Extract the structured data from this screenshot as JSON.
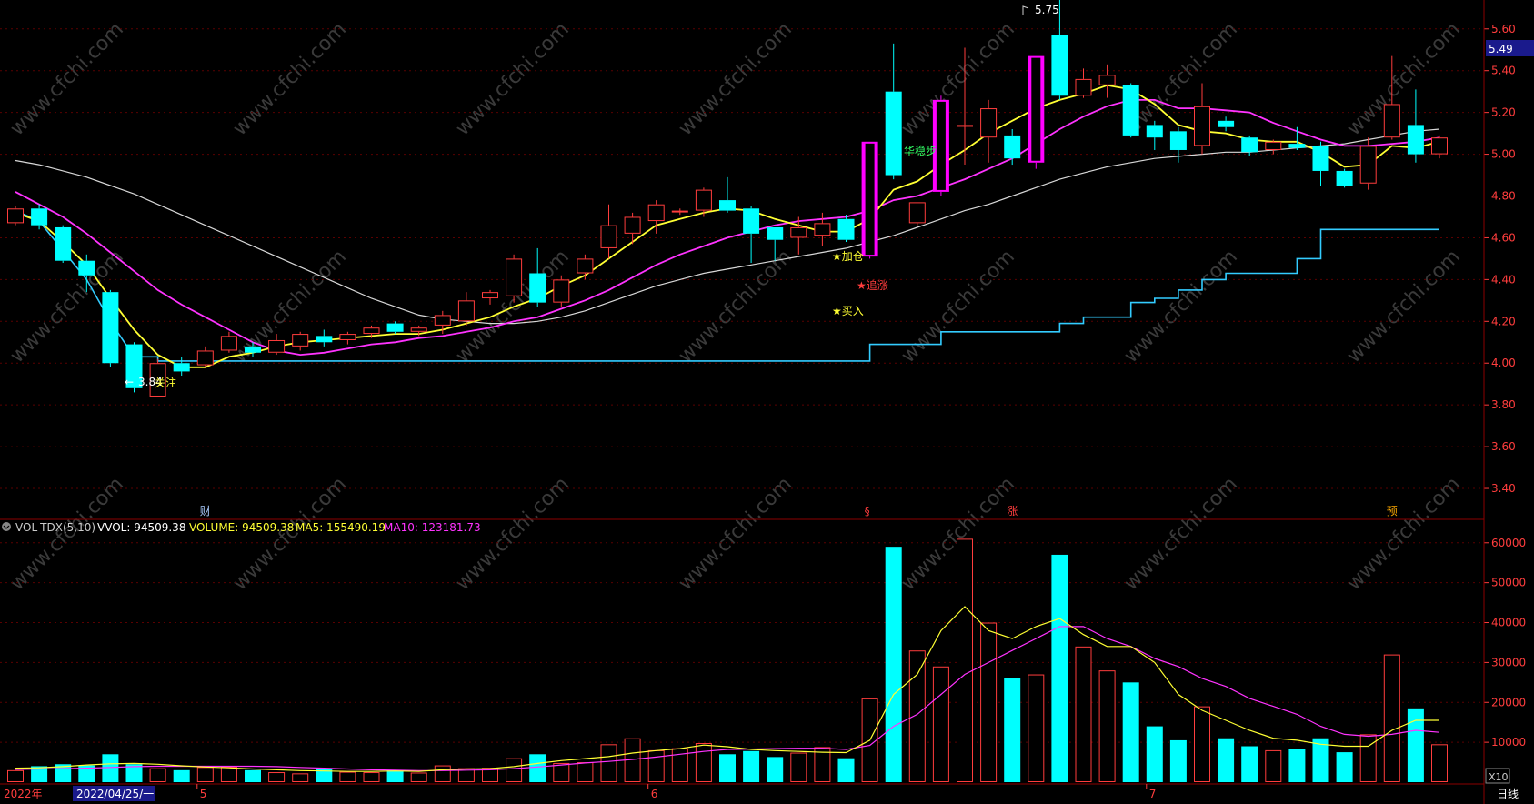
{
  "colors": {
    "background": "#000000",
    "up": "#ff3d3d",
    "down": "#00ffff",
    "ma5": "#ffff33",
    "ma10": "#ff33ff",
    "ma_long": "#d8d8d8",
    "support": "#33ccff",
    "axis_text": "#ff3d3d",
    "grid": "#5a0000",
    "signal_boost": "#ff00ff"
  },
  "price_axis": {
    "ticks": [
      "5.60",
      "5.40",
      "5.20",
      "5.00",
      "4.80",
      "4.60",
      "4.40",
      "4.20",
      "4.00",
      "3.80",
      "3.60",
      "3.40"
    ],
    "current_price_label": "5.49"
  },
  "volume_axis": {
    "ticks": [
      "60000",
      "50000",
      "40000",
      "30000",
      "20000",
      "10000"
    ],
    "multiplier_label": "X10"
  },
  "volume_header": {
    "indicator": "VOL-TDX(5,10)",
    "vvol": "VVOL: 94509.38",
    "volume": "VOLUME: 94509.38",
    "ma5": "MA5: 155490.19",
    "ma10": "MA10: 123181.73"
  },
  "date_axis": {
    "year": "2022年",
    "cursor_date": "2022/04/25/一",
    "months": [
      {
        "label": "5",
        "index": 8
      },
      {
        "label": "6",
        "index": 27
      },
      {
        "label": "7",
        "index": 48
      }
    ]
  },
  "period_label": "日线",
  "event_marks": [
    {
      "label": "财",
      "index": 8
    },
    {
      "label": "§",
      "index": 36
    },
    {
      "label": "涨",
      "index": 42
    },
    {
      "label": "预",
      "index": 58
    }
  ],
  "annotations": {
    "high_marker": "5.75",
    "low_marker": "3.84",
    "signal_watch": "关注",
    "signal_add": "★加仓",
    "signal_chase": "★追涨",
    "signal_buy": "★买入",
    "signal_steady": "华稳步"
  },
  "watermark": "www.cfchi.com",
  "chart_data": {
    "type": "candlestick",
    "period": "daily",
    "price_range": [
      3.3,
      5.66
    ],
    "volume_range": [
      0,
      62000
    ],
    "candles": [
      {
        "o": 4.67,
        "c": 4.74,
        "h": 4.75,
        "l": 4.66,
        "v": 3000
      },
      {
        "o": 4.74,
        "c": 4.66,
        "h": 4.76,
        "l": 4.64,
        "v": 4000
      },
      {
        "o": 4.65,
        "c": 4.49,
        "h": 4.66,
        "l": 4.48,
        "v": 4500
      },
      {
        "o": 4.49,
        "c": 4.42,
        "h": 4.52,
        "l": 4.34,
        "v": 4200
      },
      {
        "o": 4.34,
        "c": 4.0,
        "h": 4.35,
        "l": 3.98,
        "v": 7000
      },
      {
        "o": 4.09,
        "c": 3.88,
        "h": 4.1,
        "l": 3.86,
        "v": 4500
      },
      {
        "o": 3.84,
        "c": 4.0,
        "h": 4.02,
        "l": 3.84,
        "v": 3500
      },
      {
        "o": 4.0,
        "c": 3.96,
        "h": 4.03,
        "l": 3.94,
        "v": 3000
      },
      {
        "o": 3.99,
        "c": 4.06,
        "h": 4.08,
        "l": 3.98,
        "v": 3800
      },
      {
        "o": 4.06,
        "c": 4.13,
        "h": 4.15,
        "l": 4.05,
        "v": 3900
      },
      {
        "o": 4.08,
        "c": 4.05,
        "h": 4.1,
        "l": 4.03,
        "v": 3000
      },
      {
        "o": 4.05,
        "c": 4.11,
        "h": 4.14,
        "l": 4.04,
        "v": 2500
      },
      {
        "o": 4.08,
        "c": 4.14,
        "h": 4.15,
        "l": 4.06,
        "v": 2200
      },
      {
        "o": 4.13,
        "c": 4.1,
        "h": 4.16,
        "l": 4.08,
        "v": 3500
      },
      {
        "o": 4.11,
        "c": 4.14,
        "h": 4.15,
        "l": 4.09,
        "v": 2600
      },
      {
        "o": 4.14,
        "c": 4.17,
        "h": 4.18,
        "l": 4.12,
        "v": 2500
      },
      {
        "o": 4.19,
        "c": 4.15,
        "h": 4.2,
        "l": 4.14,
        "v": 3000
      },
      {
        "o": 4.15,
        "c": 4.17,
        "h": 4.18,
        "l": 4.13,
        "v": 2400
      },
      {
        "o": 4.18,
        "c": 4.23,
        "h": 4.25,
        "l": 4.14,
        "v": 4200
      },
      {
        "o": 4.2,
        "c": 4.3,
        "h": 4.34,
        "l": 4.18,
        "v": 3500
      },
      {
        "o": 4.31,
        "c": 4.34,
        "h": 4.35,
        "l": 4.28,
        "v": 3600
      },
      {
        "o": 4.32,
        "c": 4.5,
        "h": 4.52,
        "l": 4.29,
        "v": 6000
      },
      {
        "o": 4.43,
        "c": 4.29,
        "h": 4.55,
        "l": 4.27,
        "v": 7000
      },
      {
        "o": 4.29,
        "c": 4.4,
        "h": 4.42,
        "l": 4.27,
        "v": 4800
      },
      {
        "o": 4.43,
        "c": 4.5,
        "h": 4.52,
        "l": 4.4,
        "v": 5000
      },
      {
        "o": 4.55,
        "c": 4.66,
        "h": 4.76,
        "l": 4.5,
        "v": 9500
      },
      {
        "o": 4.62,
        "c": 4.7,
        "h": 4.72,
        "l": 4.57,
        "v": 11000
      },
      {
        "o": 4.68,
        "c": 4.76,
        "h": 4.78,
        "l": 4.62,
        "v": 8000
      },
      {
        "o": 4.73,
        "c": 4.73,
        "h": 4.74,
        "l": 4.71,
        "v": 8500
      },
      {
        "o": 4.73,
        "c": 4.83,
        "h": 4.84,
        "l": 4.7,
        "v": 9800
      },
      {
        "o": 4.78,
        "c": 4.73,
        "h": 4.89,
        "l": 4.72,
        "v": 7000
      },
      {
        "o": 4.74,
        "c": 4.62,
        "h": 4.75,
        "l": 4.48,
        "v": 7800
      },
      {
        "o": 4.65,
        "c": 4.59,
        "h": 4.65,
        "l": 4.49,
        "v": 6300
      },
      {
        "o": 4.6,
        "c": 4.65,
        "h": 4.7,
        "l": 4.52,
        "v": 7400
      },
      {
        "o": 4.61,
        "c": 4.67,
        "h": 4.72,
        "l": 4.56,
        "v": 8800
      },
      {
        "o": 4.69,
        "c": 4.59,
        "h": 4.71,
        "l": 4.58,
        "v": 6000
      },
      {
        "o": 4.51,
        "c": 5.06,
        "h": 5.06,
        "l": 4.5,
        "v": 21000
      },
      {
        "o": 5.3,
        "c": 4.9,
        "h": 5.53,
        "l": 4.88,
        "v": 59000
      },
      {
        "o": 4.67,
        "c": 4.77,
        "h": 4.77,
        "l": 4.66,
        "v": 33000
      },
      {
        "o": 4.82,
        "c": 5.26,
        "h": 5.28,
        "l": 4.8,
        "v": 29000
      },
      {
        "o": 5.14,
        "c": 5.14,
        "h": 5.51,
        "l": 4.95,
        "v": 61000
      },
      {
        "o": 5.08,
        "c": 5.22,
        "h": 5.26,
        "l": 4.96,
        "v": 40000
      },
      {
        "o": 5.09,
        "c": 4.98,
        "h": 5.12,
        "l": 4.95,
        "v": 26000
      },
      {
        "o": 4.96,
        "c": 5.47,
        "h": 5.47,
        "l": 4.93,
        "v": 27000
      },
      {
        "o": 5.57,
        "c": 5.28,
        "h": 5.75,
        "l": 5.26,
        "v": 57000
      },
      {
        "o": 5.28,
        "c": 5.36,
        "h": 5.41,
        "l": 5.27,
        "v": 34000
      },
      {
        "o": 5.33,
        "c": 5.38,
        "h": 5.43,
        "l": 5.27,
        "v": 28000
      },
      {
        "o": 5.33,
        "c": 5.09,
        "h": 5.34,
        "l": 5.08,
        "v": 25000
      },
      {
        "o": 5.14,
        "c": 5.08,
        "h": 5.16,
        "l": 5.02,
        "v": 14000
      },
      {
        "o": 5.11,
        "c": 5.02,
        "h": 5.13,
        "l": 4.96,
        "v": 10500
      },
      {
        "o": 5.04,
        "c": 5.23,
        "h": 5.34,
        "l": 5.0,
        "v": 19000
      },
      {
        "o": 5.16,
        "c": 5.13,
        "h": 5.18,
        "l": 5.11,
        "v": 11000
      },
      {
        "o": 5.08,
        "c": 5.01,
        "h": 5.09,
        "l": 4.99,
        "v": 9000
      },
      {
        "o": 5.02,
        "c": 5.06,
        "h": 5.07,
        "l": 5.0,
        "v": 8000
      },
      {
        "o": 5.05,
        "c": 5.03,
        "h": 5.13,
        "l": 5.02,
        "v": 8300
      },
      {
        "o": 5.04,
        "c": 4.92,
        "h": 5.06,
        "l": 4.85,
        "v": 11000
      },
      {
        "o": 4.92,
        "c": 4.85,
        "h": 4.93,
        "l": 4.84,
        "v": 7500
      },
      {
        "o": 4.86,
        "c": 5.04,
        "h": 5.08,
        "l": 4.83,
        "v": 12000
      },
      {
        "o": 5.08,
        "c": 5.24,
        "h": 5.47,
        "l": 5.07,
        "v": 32000
      },
      {
        "o": 5.14,
        "c": 5.0,
        "h": 5.31,
        "l": 4.96,
        "v": 18500
      },
      {
        "o": 5.0,
        "c": 5.08,
        "h": 5.09,
        "l": 4.98,
        "v": 9500
      }
    ],
    "ma5": [
      4.72,
      4.68,
      4.58,
      4.47,
      4.31,
      4.16,
      4.04,
      3.98,
      3.98,
      4.03,
      4.05,
      4.08,
      4.1,
      4.11,
      4.12,
      4.13,
      4.14,
      4.14,
      4.16,
      4.19,
      4.22,
      4.27,
      4.31,
      4.37,
      4.42,
      4.5,
      4.58,
      4.66,
      4.69,
      4.72,
      4.74,
      4.73,
      4.69,
      4.66,
      4.63,
      4.63,
      4.69,
      4.83,
      4.87,
      4.95,
      5.02,
      5.1,
      5.16,
      5.22,
      5.26,
      5.29,
      5.33,
      5.31,
      5.24,
      5.14,
      5.11,
      5.1,
      5.07,
      5.06,
      5.06,
      5.01,
      4.94,
      4.95,
      5.04,
      5.03,
      5.06
    ],
    "ma10": [
      4.82,
      4.76,
      4.7,
      4.62,
      4.53,
      4.44,
      4.35,
      4.28,
      4.22,
      4.16,
      4.1,
      4.06,
      4.04,
      4.05,
      4.07,
      4.09,
      4.1,
      4.12,
      4.13,
      4.15,
      4.17,
      4.2,
      4.22,
      4.26,
      4.3,
      4.35,
      4.41,
      4.47,
      4.52,
      4.56,
      4.6,
      4.63,
      4.66,
      4.68,
      4.69,
      4.7,
      4.73,
      4.78,
      4.8,
      4.84,
      4.88,
      4.93,
      4.98,
      5.05,
      5.12,
      5.18,
      5.23,
      5.26,
      5.26,
      5.22,
      5.22,
      5.21,
      5.2,
      5.15,
      5.11,
      5.07,
      5.04,
      5.04,
      5.05,
      5.06,
      5.08
    ],
    "ma_long": [
      4.97,
      4.95,
      4.92,
      4.89,
      4.85,
      4.81,
      4.76,
      4.71,
      4.66,
      4.61,
      4.56,
      4.51,
      4.46,
      4.41,
      4.36,
      4.31,
      4.27,
      4.23,
      4.21,
      4.2,
      4.19,
      4.19,
      4.2,
      4.22,
      4.25,
      4.29,
      4.33,
      4.37,
      4.4,
      4.43,
      4.45,
      4.47,
      4.49,
      4.51,
      4.53,
      4.55,
      4.58,
      4.61,
      4.65,
      4.69,
      4.73,
      4.76,
      4.8,
      4.84,
      4.88,
      4.91,
      4.94,
      4.96,
      4.98,
      4.99,
      5.0,
      5.01,
      5.01,
      5.02,
      5.03,
      5.04,
      5.05,
      5.07,
      5.09,
      5.11,
      5.12
    ],
    "support_line": [
      4.73,
      4.68,
      4.54,
      4.4,
      4.2,
      4.03,
      4.01,
      4.01,
      4.01,
      4.01,
      4.01,
      4.01,
      4.01,
      4.01,
      4.01,
      4.01,
      4.01,
      4.01,
      4.01,
      4.01,
      4.01,
      4.01,
      4.01,
      4.01,
      4.01,
      4.01,
      4.01,
      4.01,
      4.01,
      4.01,
      4.01,
      4.01,
      4.01,
      4.01,
      4.01,
      4.01,
      4.09,
      4.09,
      4.09,
      4.15,
      4.15,
      4.15,
      4.15,
      4.15,
      4.19,
      4.22,
      4.22,
      4.29,
      4.31,
      4.35,
      4.4,
      4.43,
      4.43,
      4.43,
      4.5,
      4.64,
      4.64,
      4.64,
      4.64,
      4.64,
      4.64
    ],
    "vol_ma5": [
      3500,
      3600,
      3900,
      4300,
      4600,
      4700,
      4500,
      4100,
      3800,
      3600,
      3300,
      3100,
      2900,
      2800,
      2700,
      2700,
      2800,
      2700,
      3100,
      3300,
      3400,
      3900,
      4700,
      5400,
      5900,
      6400,
      7300,
      7900,
      8400,
      9300,
      8900,
      8200,
      7900,
      7700,
      7500,
      7400,
      10500,
      22000,
      27000,
      38000,
      44000,
      38000,
      36000,
      39000,
      41000,
      37000,
      34000,
      34000,
      30000,
      22000,
      18000,
      15500,
      13000,
      11000,
      10500,
      9500,
      9000,
      9000,
      13000,
      15500,
      15500
    ],
    "vol_ma10": [
      3200,
      3300,
      3400,
      3500,
      3700,
      3900,
      4000,
      4000,
      4000,
      4000,
      4000,
      3900,
      3700,
      3500,
      3300,
      3100,
      3000,
      2900,
      2900,
      3000,
      3100,
      3400,
      3800,
      4300,
      4800,
      5200,
      5700,
      6300,
      7000,
      7700,
      8200,
      8300,
      8400,
      8500,
      8500,
      8200,
      9200,
      14000,
      17000,
      22000,
      27000,
      30000,
      33000,
      36000,
      39000,
      39000,
      36000,
      34000,
      31000,
      29000,
      26000,
      24000,
      21000,
      19000,
      17000,
      14000,
      12000,
      11500,
      12000,
      13000,
      12500
    ]
  }
}
